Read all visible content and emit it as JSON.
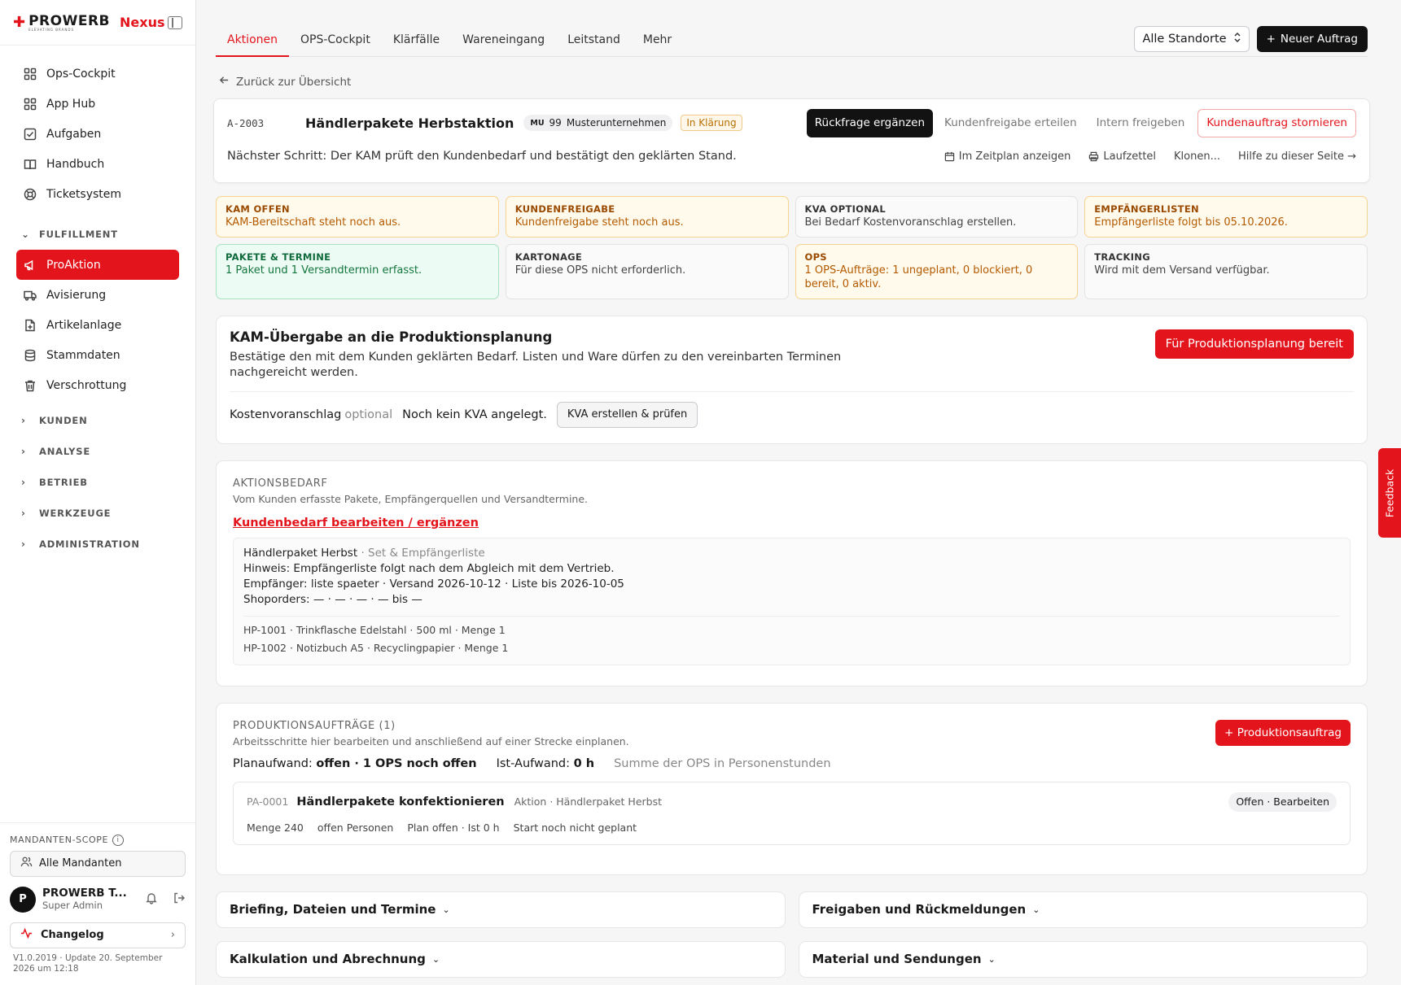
{
  "brand": {
    "name": "PROWERB",
    "tagline": "ELEVATING BRANDS",
    "product": "Nexus"
  },
  "sidebar": {
    "items": [
      {
        "label": "Ops-Cockpit",
        "icon": "grid-icon"
      },
      {
        "label": "App Hub",
        "icon": "apps-icon"
      },
      {
        "label": "Aufgaben",
        "icon": "checkbox-icon"
      },
      {
        "label": "Handbuch",
        "icon": "book-icon"
      },
      {
        "label": "Ticketsystem",
        "icon": "lifebuoy-icon"
      }
    ],
    "fulfillment": {
      "label": "FULFILLMENT",
      "items": [
        {
          "label": "ProAktion",
          "icon": "megaphone-icon",
          "active": true
        },
        {
          "label": "Avisierung",
          "icon": "truck-icon"
        },
        {
          "label": "Artikelanlage",
          "icon": "file-plus-icon"
        },
        {
          "label": "Stammdaten",
          "icon": "database-icon"
        },
        {
          "label": "Verschrottung",
          "icon": "trash-icon"
        }
      ]
    },
    "sections": [
      "KUNDEN",
      "ANALYSE",
      "BETRIEB",
      "WERKZEUGE",
      "ADMINISTRATION"
    ],
    "scope_label": "MANDANTEN-SCOPE",
    "scope_value": "Alle Mandanten",
    "user": {
      "initial": "P",
      "name": "PROWERB T...",
      "role": "Super Admin"
    },
    "changelog": "Changelog",
    "version": "V1.0.2019 · Update 20. September 2026 um 12:18"
  },
  "topbar": {
    "tabs": [
      "Aktionen",
      "OPS-Cockpit",
      "Klärfälle",
      "Wareneingang",
      "Leitstand",
      "Mehr"
    ],
    "active_tab": "Aktionen",
    "location": "Alle Standorte",
    "new_order": "Neuer Auftrag"
  },
  "back_link": "Zurück zur Übersicht",
  "order": {
    "id": "A-2003",
    "title": "Händlerpakete Herbstaktion",
    "client_code": "MU",
    "client_number": "99",
    "client_name": "Musterunternehmen",
    "status": "In Klärung",
    "actions": {
      "primary": "Rückfrage ergänzen",
      "release_customer": "Kundenfreigabe erteilen",
      "release_internal": "Intern freigeben",
      "cancel": "Kundenauftrag stornieren"
    },
    "next_step": "Nächster Schritt: Der KAM prüft den Kundenbedarf und bestätigt den geklärten Stand.",
    "links": {
      "schedule": "Im Zeitplan anzeigen",
      "slip": "Laufzettel",
      "clone": "Klonen...",
      "help": "Hilfe zu dieser Seite →"
    }
  },
  "status_tiles": [
    {
      "label": "KAM OFFEN",
      "text": "KAM-Bereitschaft steht noch aus.",
      "tone": "warn"
    },
    {
      "label": "KUNDENFREIGABE",
      "text": "Kundenfreigabe steht noch aus.",
      "tone": "warn"
    },
    {
      "label": "KVA OPTIONAL",
      "text": "Bei Bedarf Kostenvoranschlag erstellen.",
      "tone": "neutral"
    },
    {
      "label": "EMPFÄNGERLISTEN",
      "text": "Empfängerliste folgt bis 05.10.2026.",
      "tone": "warn"
    },
    {
      "label": "PAKETE & TERMINE",
      "text": "1 Paket und 1 Versandtermin erfasst.",
      "tone": "ok"
    },
    {
      "label": "KARTONAGE",
      "text": "Für diese OPS nicht erforderlich.",
      "tone": "neutral"
    },
    {
      "label": "OPS",
      "text": "1 OPS-Aufträge: 1 ungeplant, 0 blockiert, 0 bereit, 0 aktiv.",
      "tone": "warn"
    },
    {
      "label": "TRACKING",
      "text": "Wird mit dem Versand verfügbar.",
      "tone": "neutral"
    }
  ],
  "kam": {
    "title": "KAM-Übergabe an die Produktionsplanung",
    "description": "Bestätige den mit dem Kunden geklärten Bedarf. Listen und Ware dürfen zu den vereinbarten Terminen nachgereicht werden.",
    "button": "Für Produktionsplanung bereit",
    "kva_label": "Kostenvoranschlag",
    "kva_optional": "optional",
    "kva_status": "Noch kein KVA angelegt.",
    "kva_button": "KVA erstellen & prüfen"
  },
  "bedarf": {
    "label": "AKTIONSBEDARF",
    "sub": "Vom Kunden erfasste Pakete, Empfängerquellen und Versandtermine.",
    "link": "Kundenbedarf bearbeiten / ergänzen",
    "package_name": "Händlerpaket Herbst",
    "package_type": "· Set & Empfängerliste",
    "hint": "Hinweis: Empfängerliste folgt nach dem Abgleich mit dem Vertrieb.",
    "recipients": "Empfänger: liste spaeter · Versand 2026-10-12 · Liste bis 2026-10-05",
    "shoporders": "Shoporders: — · — · — · — bis —",
    "items": [
      "HP-1001 · Trinkflasche Edelstahl · 500 ml · Menge 1",
      "HP-1002 · Notizbuch A5 · Recyclingpapier · Menge 1"
    ]
  },
  "production": {
    "label": "PRODUKTIONSAUFTRÄGE (1)",
    "sub": "Arbeitsschritte hier bearbeiten und anschließend auf einer Strecke einplanen.",
    "add_button": "+ Produktionsauftrag",
    "plan_label": "Planaufwand:",
    "plan_value": "offen · 1 OPS noch offen",
    "ist_label": "Ist-Aufwand:",
    "ist_value": "0 h",
    "sum_note": "Summe der OPS in Personenstunden",
    "order": {
      "id": "PA-0001",
      "title": "Händlerpakete konfektionieren",
      "meta": "Aktion · Händlerpaket Herbst",
      "status": "Offen · Bearbeiten",
      "details": [
        "Menge 240",
        "offen Personen",
        "Plan offen · Ist 0 h",
        "Start noch nicht geplant"
      ]
    }
  },
  "accordions": [
    "Briefing, Dateien und Termine",
    "Freigaben und Rückmeldungen",
    "Kalkulation und Abrechnung",
    "Material und Sendungen"
  ],
  "feedback": "Feedback",
  "colors": {
    "accent": "#e3141b",
    "dark": "#121212",
    "warn_bg": "#fffaeb",
    "ok_bg": "#ecfbf3"
  }
}
